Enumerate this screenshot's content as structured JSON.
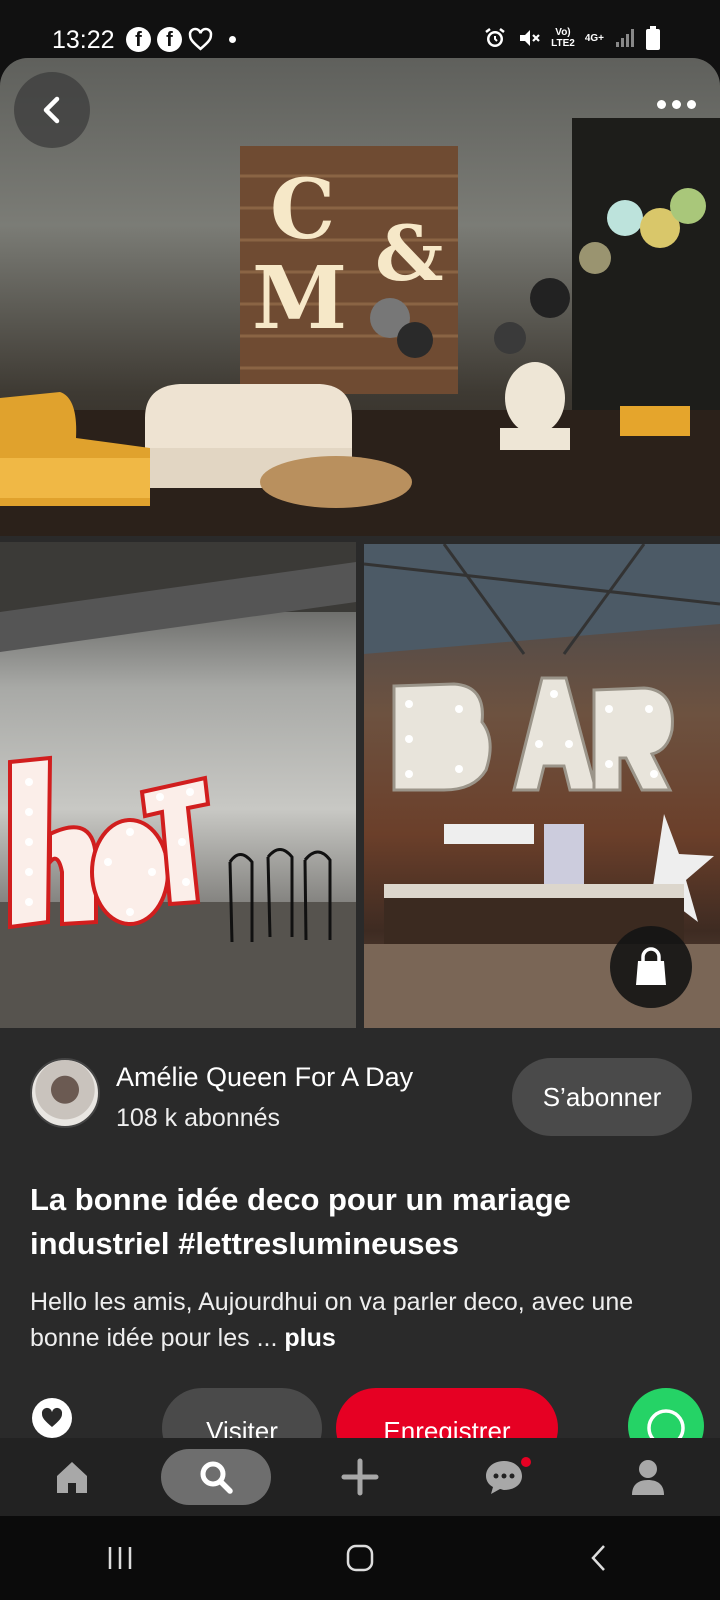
{
  "status_bar": {
    "time": "13:22",
    "left_icons": [
      "facebook-icon",
      "facebook-icon",
      "heart-outline-icon",
      "dot"
    ],
    "network_label_top": "Vo)",
    "network_label_bottom": "LTE2",
    "data_label": "4G+",
    "right_icons": [
      "alarm-icon",
      "mute-icon",
      "signal-icon",
      "battery-icon"
    ]
  },
  "pin_images": [
    {
      "name": "wedding-lounge-marquee-letters",
      "letters": "C & M"
    },
    {
      "name": "marquee-letters-hot",
      "letters": "hot"
    },
    {
      "name": "marquee-letters-bar",
      "letters": "BAR"
    }
  ],
  "creator": {
    "name": "Amélie Queen For A Day",
    "followers": "108 k abonnés",
    "follow_label": "S’abonner"
  },
  "pin": {
    "title": "La bonne idée deco pour un mariage industriel #lettreslumineuses",
    "description": "Hello les amis, Aujourdhui on va parler deco, avec une bonne idée pour les ...",
    "more_label": "plus"
  },
  "actions": {
    "visit_label": "Visiter",
    "save_label": "Enregistrer"
  },
  "bottom_nav": [
    "home-icon",
    "search-icon",
    "plus-icon",
    "messages-icon",
    "profile-icon"
  ],
  "colors": {
    "save_red": "#e60023",
    "whatsapp_green": "#25d366",
    "card_bg": "#2a2a2a"
  }
}
